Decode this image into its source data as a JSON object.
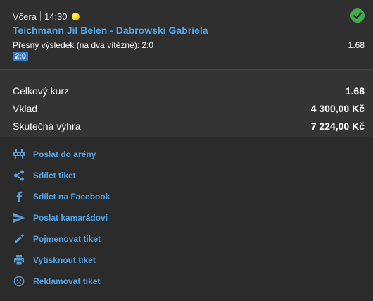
{
  "bet": {
    "day": "Včera",
    "time": "14:30",
    "sport_icon": "tennis-ball-icon",
    "status_icon": "check-circle-icon",
    "match": "Teichmann Jil Belen - Dabrowski Gabriela",
    "market": "Přesný výsledek (na dva vítězné): 2:0",
    "odd": "1.68",
    "pick": "2:0"
  },
  "summary": {
    "total_odds_label": "Celkový kurz",
    "total_odds_value": "1.68",
    "stake_label": "Vklad",
    "stake_value": "4 300,00 Kč",
    "win_label": "Skutečná výhra",
    "win_value": "7 224,00 Kč"
  },
  "actions": [
    {
      "label": "Poslat do arény",
      "icon": "arena-icon"
    },
    {
      "label": "Sdílet tiket",
      "icon": "share-icon"
    },
    {
      "label": "Sdílet na Facebook",
      "icon": "facebook-icon"
    },
    {
      "label": "Poslat kamarádovi",
      "icon": "send-icon"
    },
    {
      "label": "Pojmenovat tiket",
      "icon": "pencil-icon"
    },
    {
      "label": "Vytisknout tiket",
      "icon": "printer-icon"
    },
    {
      "label": "Reklamovat tiket",
      "icon": "sad-face-icon"
    }
  ],
  "colors": {
    "link": "#4fa3e6",
    "success": "#3caf4a",
    "pick_badge": "#2d7dd2",
    "icon": "#5b9bd5"
  }
}
